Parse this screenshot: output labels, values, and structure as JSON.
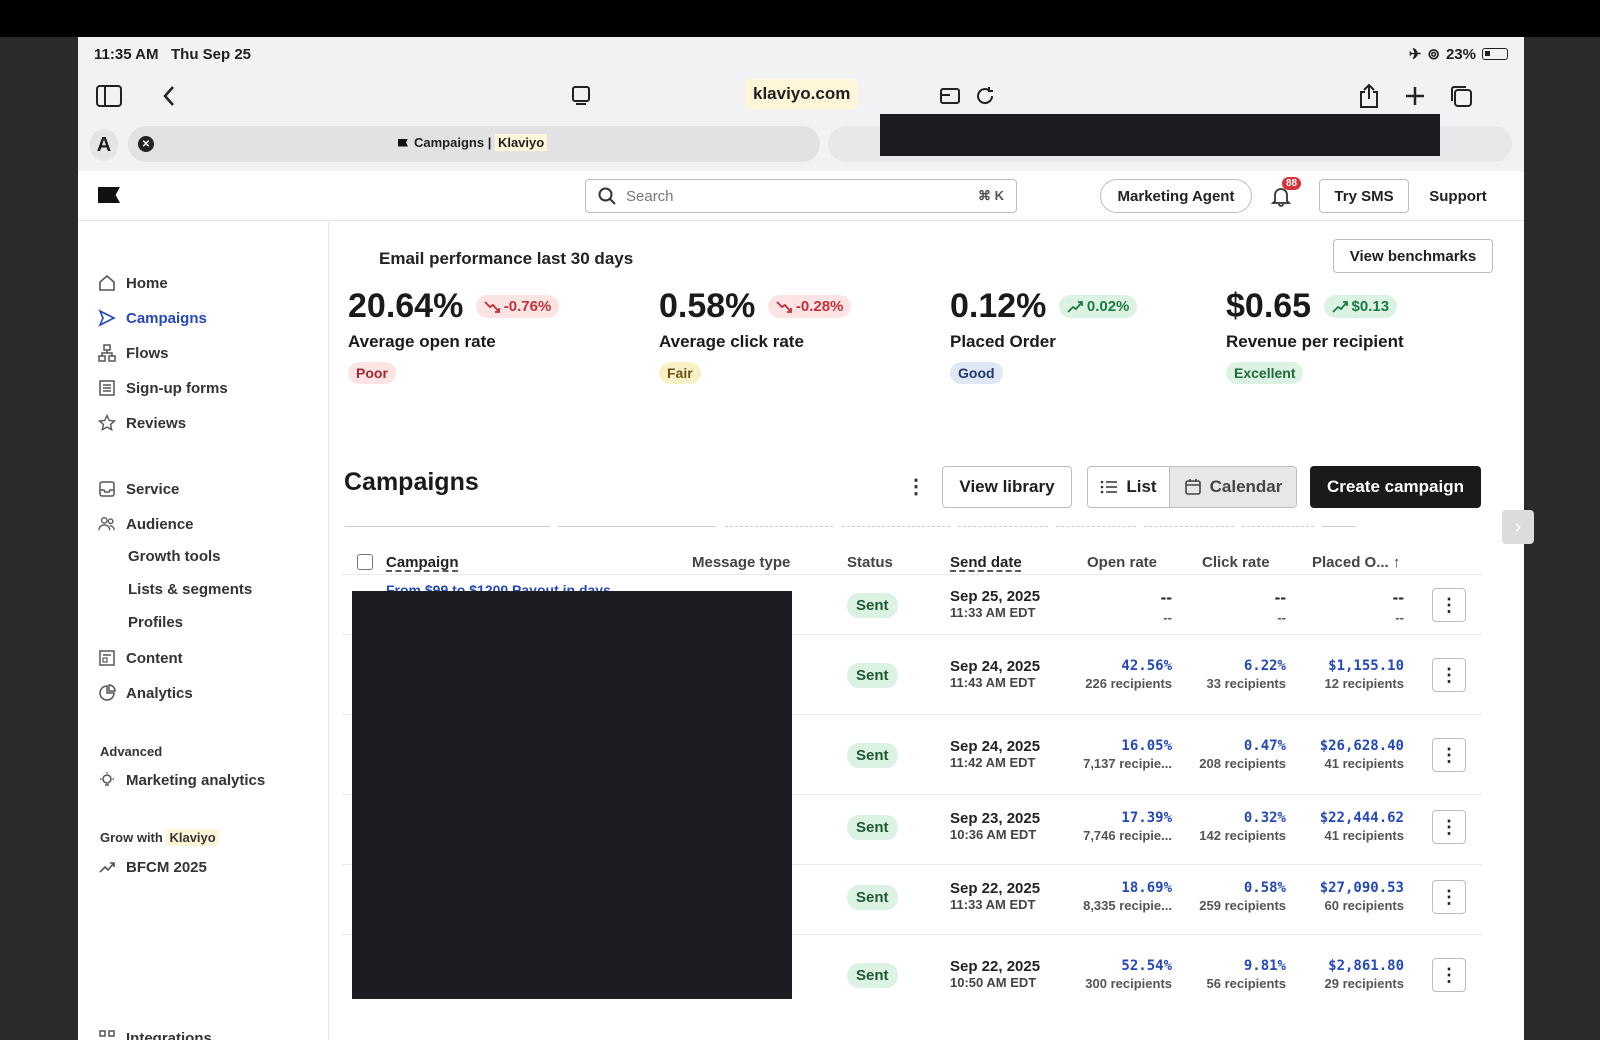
{
  "ios": {
    "time": "11:35 AM",
    "date": "Thu Sep 25",
    "battery": "23%"
  },
  "safari": {
    "url": "klaviyo.com",
    "tab_title": "Campaigns",
    "tab_site": "Klaviyo"
  },
  "header": {
    "search_placeholder": "Search",
    "search_shortcut": "⌘ K",
    "marketing_agent": "Marketing Agent",
    "notif_count": "88",
    "try_sms": "Try SMS",
    "support": "Support"
  },
  "sidebar": {
    "home": "Home",
    "campaigns": "Campaigns",
    "flows": "Flows",
    "signup": "Sign-up forms",
    "reviews": "Reviews",
    "service": "Service",
    "audience": "Audience",
    "growth": "Growth tools",
    "lists": "Lists & segments",
    "profiles": "Profiles",
    "content": "Content",
    "analytics": "Analytics",
    "advanced_caption": "Advanced",
    "marketing_analytics": "Marketing analytics",
    "grow_caption": "Grow with",
    "grow_brand": "Klaviyo",
    "bfcm": "BFCM 2025",
    "integrations": "Integrations"
  },
  "performance": {
    "title": "Email performance last 30 days",
    "bench_button": "View benchmarks",
    "metrics": [
      {
        "value": "20.64%",
        "change": "-0.76%",
        "label": "Average open rate",
        "rating": "Poor"
      },
      {
        "value": "0.58%",
        "change": "-0.28%",
        "label": "Average click rate",
        "rating": "Fair"
      },
      {
        "value": "0.12%",
        "change": "0.02%",
        "label": "Placed Order",
        "rating": "Good"
      },
      {
        "value": "$0.65",
        "change": "$0.13",
        "label": "Revenue per recipient",
        "rating": "Excellent"
      }
    ]
  },
  "campaigns": {
    "title": "Campaigns",
    "view_library": "View library",
    "list": "List",
    "calendar": "Calendar",
    "create": "Create campaign",
    "columns": {
      "campaign": "Campaign",
      "message_type": "Message type",
      "status": "Status",
      "send_date": "Send date",
      "open_rate": "Open rate",
      "click_rate": "Click rate",
      "placed": "Placed O... ↑"
    },
    "first_campaign_name": "From $99 to $1200 Payout in days",
    "rows": [
      {
        "status": "Sent",
        "date": "Sep 25, 2025",
        "time": "11:33 AM EDT",
        "open": "--",
        "open_sub": "--",
        "click": "--",
        "click_sub": "--",
        "placed": "--",
        "placed_sub": "--"
      },
      {
        "status": "Sent",
        "date": "Sep 24, 2025",
        "time": "11:43 AM EDT",
        "open": "42.56%",
        "open_sub": "226 recipients",
        "click": "6.22%",
        "click_sub": "33 recipients",
        "placed": "$1,155.10",
        "placed_sub": "12 recipients"
      },
      {
        "status": "Sent",
        "date": "Sep 24, 2025",
        "time": "11:42 AM EDT",
        "open": "16.05%",
        "open_sub": "7,137 recipie...",
        "click": "0.47%",
        "click_sub": "208 recipients",
        "placed": "$26,628.40",
        "placed_sub": "41 recipients"
      },
      {
        "status": "Sent",
        "date": "Sep 23, 2025",
        "time": "10:36 AM EDT",
        "open": "17.39%",
        "open_sub": "7,746 recipie...",
        "click": "0.32%",
        "click_sub": "142 recipients",
        "placed": "$22,444.62",
        "placed_sub": "41 recipients"
      },
      {
        "status": "Sent",
        "date": "Sep 22, 2025",
        "time": "11:33 AM EDT",
        "open": "18.69%",
        "open_sub": "8,335 recipie...",
        "click": "0.58%",
        "click_sub": "259 recipients",
        "placed": "$27,090.53",
        "placed_sub": "60 recipients"
      },
      {
        "status": "Sent",
        "date": "Sep 22, 2025",
        "time": "10:50 AM EDT",
        "open": "52.54%",
        "open_sub": "300 recipients",
        "click": "9.81%",
        "click_sub": "56 recipients",
        "placed": "$2,861.80",
        "placed_sub": "29 recipients"
      }
    ]
  }
}
